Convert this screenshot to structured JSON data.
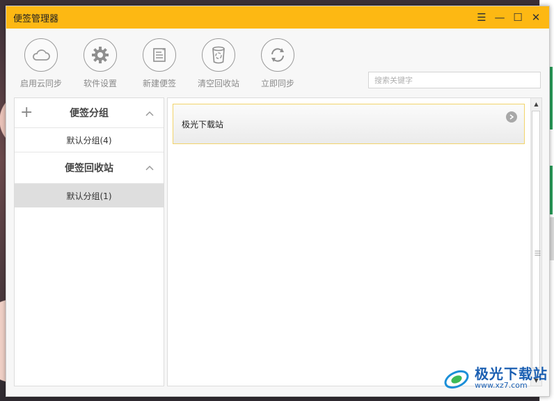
{
  "window": {
    "title": "便签管理器",
    "accent_color": "#fdb813"
  },
  "titlebar_controls": {
    "menu": "☰",
    "minimize": "—",
    "maximize": "☐",
    "close": "✕"
  },
  "toolbar": {
    "items": [
      {
        "label": "启用云同步",
        "icon": "cloud-icon"
      },
      {
        "label": "软件设置",
        "icon": "gear-icon"
      },
      {
        "label": "新建便签",
        "icon": "new-note-icon"
      },
      {
        "label": "清空回收站",
        "icon": "recycle-bin-icon"
      },
      {
        "label": "立即同步",
        "icon": "sync-icon"
      }
    ]
  },
  "search": {
    "placeholder": "搜索关键字",
    "value": ""
  },
  "sidebar": {
    "groups_header": "便签分组",
    "groups_items": [
      "默认分组(4)"
    ],
    "recycle_header": "便签回收站",
    "recycle_items": [
      "默认分组(1)"
    ]
  },
  "notes": [
    {
      "title": "极光下载站"
    }
  ],
  "watermark": {
    "main": "极光下载站",
    "sub": "www.xz7.com"
  }
}
